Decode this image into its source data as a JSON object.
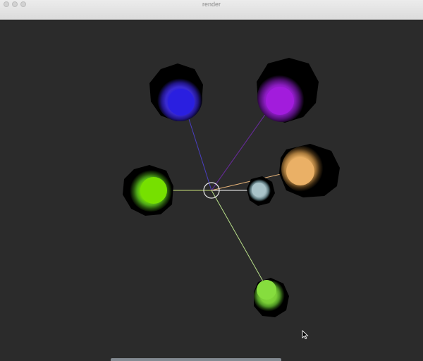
{
  "window": {
    "title": "render"
  },
  "icons": {
    "close": "close-icon",
    "minimize": "minimize-icon",
    "maximize": "maximize-icon",
    "cursor": "cursor-arrow-icon"
  },
  "scene": {
    "background": "#2b2b2b",
    "hub": {
      "stroke": "#e6e6e6"
    },
    "nodes": [
      {
        "id": "blue",
        "core": "#2a1fe0",
        "glow": "#4a3ad4",
        "link": "#4a3ec0"
      },
      {
        "id": "purple",
        "core": "#a21cdc",
        "glow": "#7f20b8",
        "link": "#6a2aa0"
      },
      {
        "id": "green-left",
        "core": "#76e000",
        "glow": "#4caa10",
        "link": "#c9e27a"
      },
      {
        "id": "slate",
        "core": "#a9c3c9",
        "glow": "#6e8a92",
        "link": "#ffffff"
      },
      {
        "id": "orange",
        "core": "#eab066",
        "glow": "#b07f3a",
        "link": "#e8b57a"
      },
      {
        "id": "green-bottom",
        "core": "#7ed23a",
        "glow": "#4f9624",
        "link": "#b9e08a"
      }
    ]
  }
}
